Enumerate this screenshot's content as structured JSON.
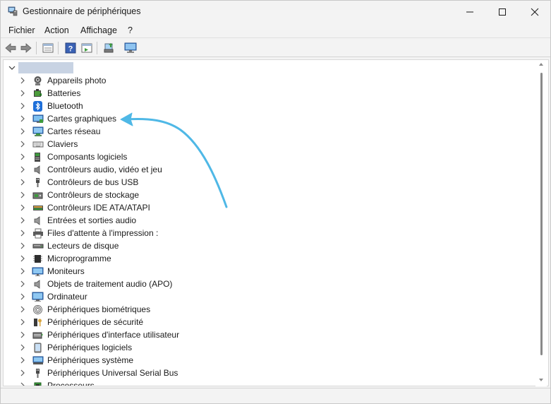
{
  "window": {
    "title": "Gestionnaire de périphériques",
    "controls": [
      "minimize-icon",
      "maximize-icon",
      "close-icon"
    ]
  },
  "menu": {
    "items": [
      "Fichier",
      "Action",
      "Affichage",
      "?"
    ]
  },
  "toolbar": {
    "buttons": [
      "back-arrow-icon",
      "forward-arrow-icon",
      "properties-panel-icon",
      "help-icon",
      "view-panel-icon",
      "scan-hardware-icon",
      "monitor-icon"
    ]
  },
  "tree": {
    "root_label": "",
    "categories": [
      {
        "label": "Appareils photo",
        "icon": "camera-icon"
      },
      {
        "label": "Batteries",
        "icon": "battery-icon"
      },
      {
        "label": "Bluetooth",
        "icon": "bluetooth-icon"
      },
      {
        "label": "Cartes graphiques",
        "icon": "display-adapter-icon"
      },
      {
        "label": "Cartes réseau",
        "icon": "network-adapter-icon"
      },
      {
        "label": "Claviers",
        "icon": "keyboard-icon"
      },
      {
        "label": "Composants logiciels",
        "icon": "software-component-icon"
      },
      {
        "label": "Contrôleurs audio, vidéo et jeu",
        "icon": "audio-controller-icon"
      },
      {
        "label": "Contrôleurs de bus USB",
        "icon": "usb-icon"
      },
      {
        "label": "Contrôleurs de stockage",
        "icon": "storage-controller-icon"
      },
      {
        "label": "Contrôleurs IDE ATA/ATAPI",
        "icon": "ide-controller-icon"
      },
      {
        "label": "Entrées et sorties audio",
        "icon": "speaker-icon"
      },
      {
        "label": "Files d'attente à l'impression :",
        "icon": "printer-icon"
      },
      {
        "label": "Lecteurs de disque",
        "icon": "disk-drive-icon"
      },
      {
        "label": "Microprogramme",
        "icon": "firmware-chip-icon"
      },
      {
        "label": "Moniteurs",
        "icon": "monitor-icon"
      },
      {
        "label": "Objets de traitement audio (APO)",
        "icon": "audio-processing-icon"
      },
      {
        "label": "Ordinateur",
        "icon": "computer-icon"
      },
      {
        "label": "Périphériques biométriques",
        "icon": "fingerprint-icon"
      },
      {
        "label": "Périphériques de sécurité",
        "icon": "security-key-icon"
      },
      {
        "label": "Périphériques d'interface utilisateur",
        "icon": "hid-icon"
      },
      {
        "label": "Périphériques logiciels",
        "icon": "software-device-icon"
      },
      {
        "label": "Périphériques système",
        "icon": "system-device-icon"
      },
      {
        "label": "Périphériques Universal Serial Bus",
        "icon": "usb-plug-icon"
      },
      {
        "label": "Processeurs",
        "icon": "processor-icon"
      }
    ]
  },
  "colors": {
    "annotation_arrow": "#4fb8e6",
    "window_bg": "#f3f3f3",
    "tree_bg": "#ffffff"
  }
}
